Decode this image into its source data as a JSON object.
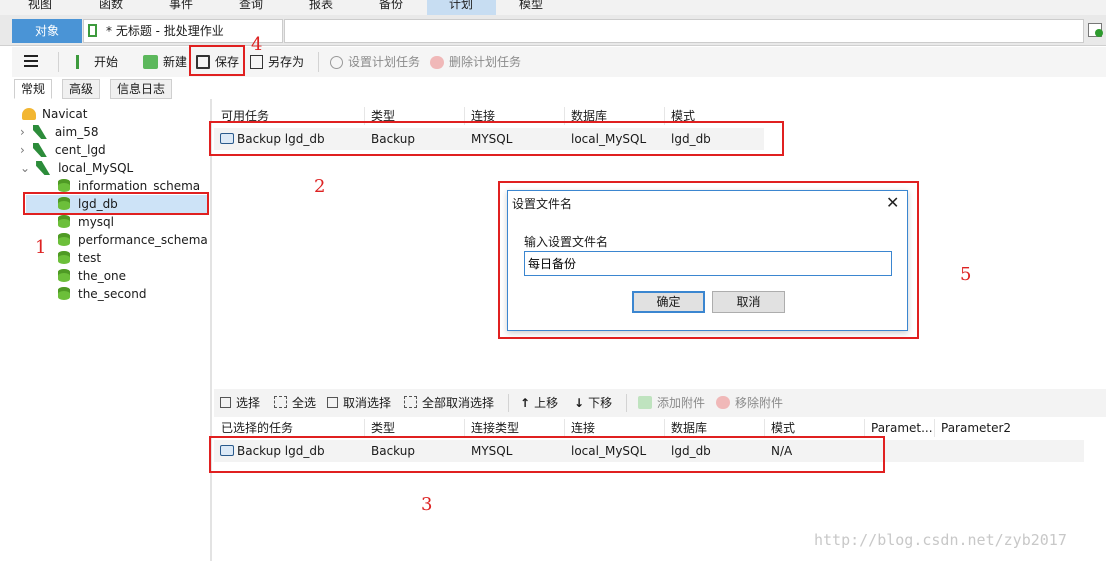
{
  "menubar": {
    "items": [
      "视图",
      "函数",
      "事件",
      "查询",
      "报表",
      "备份",
      "计划",
      "模型"
    ]
  },
  "tabs": {
    "object_tab": "对象",
    "job_tab": "* 无标题 - 批处理作业"
  },
  "toolbar": {
    "start": "开始",
    "new": "新建",
    "save": "保存",
    "save_as": "另存为",
    "set_schedule": "设置计划任务",
    "delete_schedule": "删除计划任务"
  },
  "subtabs": [
    "常规",
    "高级",
    "信息日志"
  ],
  "tree": {
    "root": "Navicat",
    "connections": [
      "aim_58",
      "cent_lgd",
      "local_MySQL"
    ],
    "databases": [
      "information_schema",
      "lgd_db",
      "mysql",
      "performance_schema",
      "test",
      "the_one",
      "the_second"
    ]
  },
  "available_tasks": {
    "headers": [
      "可用任务",
      "类型",
      "连接",
      "数据库",
      "模式"
    ],
    "rows": [
      [
        "Backup lgd_db",
        "Backup",
        "MYSQL",
        "local_MySQL",
        "lgd_db"
      ]
    ]
  },
  "selection_toolbar": {
    "select": "选择",
    "select_all": "全选",
    "deselect": "取消选择",
    "deselect_all": "全部取消选择",
    "move_up": "上移",
    "move_down": "下移",
    "add_attachment": "添加附件",
    "remove_attachment": "移除附件"
  },
  "selected_tasks": {
    "headers": [
      "已选择的任务",
      "类型",
      "连接类型",
      "连接",
      "数据库",
      "模式",
      "Paramet...",
      "Parameter2"
    ],
    "rows": [
      [
        "Backup lgd_db",
        "Backup",
        "MYSQL",
        "local_MySQL",
        "lgd_db",
        "N/A"
      ]
    ]
  },
  "dialog": {
    "title": "设置文件名",
    "label": "输入设置文件名",
    "value": "每日备份",
    "ok": "确定",
    "cancel": "取消"
  },
  "annotations": [
    "1",
    "2",
    "3",
    "4",
    "5"
  ],
  "watermark": "http://blog.csdn.net/zyb2017",
  "colors": {
    "accent": "#4a94d6",
    "annotation_red": "#e02020"
  }
}
